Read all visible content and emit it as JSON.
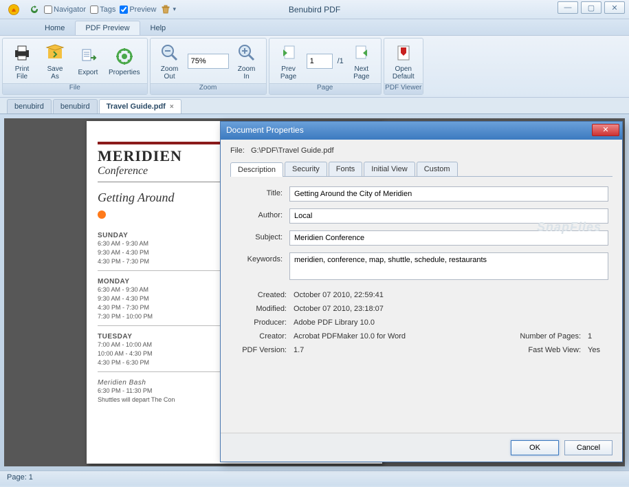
{
  "app": {
    "title": "Benubird PDF"
  },
  "titlebar_checks": {
    "navigator": {
      "label": "Navigator",
      "checked": false
    },
    "tags": {
      "label": "Tags",
      "checked": false
    },
    "preview": {
      "label": "Preview",
      "checked": true
    }
  },
  "menu_tabs": {
    "home": "Home",
    "pdf_preview": "PDF Preview",
    "help": "Help"
  },
  "ribbon": {
    "print_file": "Print\nFile",
    "save_as": "Save\nAs",
    "export": "Export",
    "properties": "Properties",
    "group_file": "File",
    "zoom_out": "Zoom\nOut",
    "zoom_value": "75%",
    "zoom_in": "Zoom\nIn",
    "group_zoom": "Zoom",
    "prev_page": "Prev\nPage",
    "page_value": "1",
    "page_total": "/1",
    "next_page": "Next\nPage",
    "group_page": "Page",
    "open_default": "Open\nDefault",
    "group_viewer": "PDF Viewer"
  },
  "doc_tabs": {
    "t1": "benubird",
    "t2": "benubird",
    "t3": "Travel Guide.pdf",
    "close": "×"
  },
  "page_content": {
    "brand": "MERIDIEN",
    "conf": "Conference",
    "title": "Getting Around",
    "days": {
      "sun": "SUNDAY",
      "sun_1": "6:30 AM - 9:30 AM",
      "sun_2": "9:30 AM - 4:30 PM",
      "sun_3": "4:30 PM - 7:30 PM",
      "mon": "MONDAY",
      "mon_1": "6:30 AM - 9:30 AM",
      "mon_2": "9:30 AM - 4:30 PM",
      "mon_3": "4:30 PM - 7:30 PM",
      "mon_4": "7:30 PM - 10:00 PM",
      "tue": "TUESDAY",
      "tue_1": "7:00 AM - 10:00 AM",
      "tue_2": "10:00 AM - 4:30 PM",
      "tue_3": "4:30 PM - 6:30 PM",
      "bash": "Meridien Bash",
      "bash_1": "6:30 PM - 11:30 PM",
      "depart": "Shuttles will depart The Con"
    }
  },
  "statusbar": {
    "page": "Page: 1"
  },
  "dialog": {
    "title": "Document Properties",
    "file_label": "File:",
    "file_value": "G:\\PDF\\Travel Guide.pdf",
    "tabs": {
      "description": "Description",
      "security": "Security",
      "fonts": "Fonts",
      "initial_view": "Initial View",
      "custom": "Custom"
    },
    "fields": {
      "title_lbl": "Title:",
      "title_val": "Getting Around the City of Meridien",
      "author_lbl": "Author:",
      "author_val": "Local",
      "subject_lbl": "Subject:",
      "subject_val": "Meridien Conference",
      "keywords_lbl": "Keywords:",
      "keywords_val": "meridien, conference, map, shuttle, schedule, restaurants",
      "created_lbl": "Created:",
      "created_val": "October 07 2010, 22:59:41",
      "modified_lbl": "Modified:",
      "modified_val": "October 07 2010, 23:18:07",
      "producer_lbl": "Producer:",
      "producer_val": "Adobe PDF Library 10.0",
      "creator_lbl": "Creator:",
      "creator_val": "Acrobat PDFMaker 10.0 for Word",
      "pages_lbl": "Number of Pages:",
      "pages_val": "1",
      "pdfver_lbl": "PDF Version:",
      "pdfver_val": "1.7",
      "fastweb_lbl": "Fast Web View:",
      "fastweb_val": "Yes"
    },
    "buttons": {
      "ok": "OK",
      "cancel": "Cancel"
    }
  },
  "watermark": "SnapFiles"
}
